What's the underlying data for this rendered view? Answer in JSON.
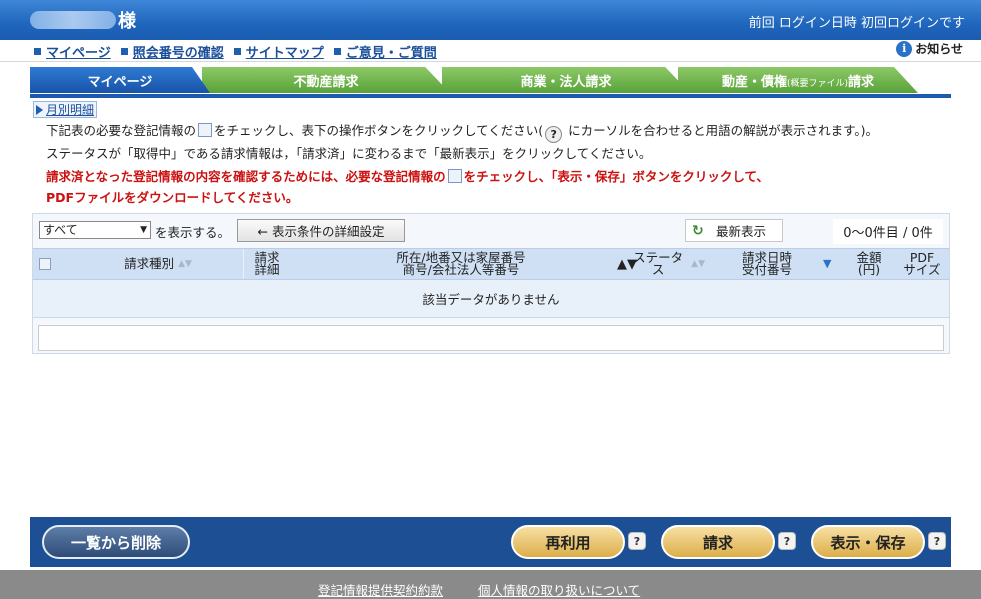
{
  "header": {
    "user_suffix": "様",
    "last_login": "前回 ログイン日時 初回ログインです"
  },
  "subnav": {
    "items": [
      "マイページ",
      "照会番号の確認",
      "サイトマップ",
      "ご意見・ご質問"
    ],
    "notice": "お知らせ",
    "notice_icon": "i"
  },
  "tabs": {
    "mypage": "マイページ",
    "real_estate": "不動産請求",
    "commercial": "商業・法人請求",
    "movable_main": "動産・債権",
    "movable_small": "(概要ファイル)",
    "movable_end": "請求"
  },
  "monthly_link": "月別明細",
  "instructions": {
    "line1a": "下記表の必要な登記情報の",
    "line1b": "をチェックし、表下の操作ボタンをクリックしてください(",
    "line1q": "?",
    "line1c": " にカーソルを合わせると用語の解説が表示されます。)。",
    "line2": "ステータスが「取得中」である請求情報は，「請求済」に変わるまで「最新表示」をクリックしてください。",
    "line3a": "請求済となった登記情報の内容を確認するためには、必要な登記情報の",
    "line3b": "をチェックし、「表示・保存」ボタンをクリックして、",
    "line4": "PDFファイルをダウンロードしてください。"
  },
  "list": {
    "filter_value": "すべて",
    "filter_arrow": "▼",
    "show_text": "を表示する。",
    "detail_button": "← 表示条件の詳細設定",
    "refresh_button": "最新表示",
    "refresh_icon": "↻",
    "count": "0～0件目 / 0件",
    "columns": {
      "type": "請求種別",
      "detail_1": "請求",
      "detail_2": "詳細",
      "location_1": "所在/地番又は家屋番号",
      "location_2": "商号/会社法人等番号",
      "status": "ステータス",
      "date_1": "請求日時",
      "date_2": "受付番号",
      "amount_1": "金額",
      "amount_2": "(円)",
      "pdf_1": "PDF",
      "pdf_2": "サイズ"
    },
    "empty_message": "該当データがありません"
  },
  "actions": {
    "delete": "一覧から削除",
    "reuse": "再利用",
    "request": "請求",
    "view_save": "表示・保存",
    "help": "?"
  },
  "footer": {
    "terms": "登記情報提供契約約款",
    "privacy": "個人情報の取り扱いについて"
  }
}
